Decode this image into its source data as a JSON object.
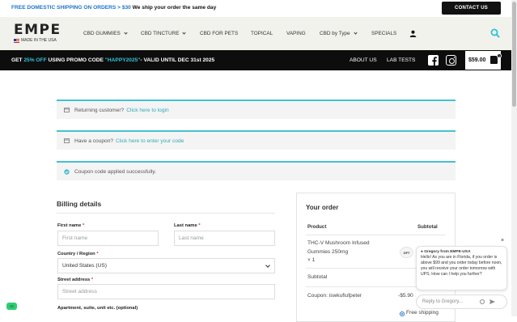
{
  "topbar": {
    "promo_prefix": "FREE DOMESTIC SHIPPING ON ORDERS > $30",
    "promo_suffix": " We ship your order the same day",
    "contact_label": "CONTACT US"
  },
  "brand": {
    "logo_word": "EMPE",
    "logo_tagline": "MADE IN THE USA"
  },
  "nav": {
    "items": [
      {
        "label": "CBD GUMMIES",
        "dropdown": true
      },
      {
        "label": "CBD TINCTURE",
        "dropdown": true
      },
      {
        "label": "CBD FOR PETS",
        "dropdown": false
      },
      {
        "label": "TOPICAL",
        "dropdown": false
      },
      {
        "label": "VAPING",
        "dropdown": false
      },
      {
        "label": "CBD by Type",
        "dropdown": true
      },
      {
        "label": "SPECIALS",
        "dropdown": false
      }
    ],
    "user_icon": "user-icon",
    "search_icon": "search-icon"
  },
  "promobar": {
    "text_a": "GET ",
    "text_pct": "25% OFF",
    "text_b": " USING PROMO CODE ",
    "text_code": "\"HAPPY2025\"",
    "text_c": "- VALID UNTIL DEC 31st 2025",
    "about_label": "ABOUT US",
    "lab_label": "LAB TESTS",
    "cart_total": "$59.00",
    "cart_count": "1"
  },
  "notices": {
    "returning_text": "Returning customer?",
    "returning_link": "Click here to login",
    "coupon_text": "Have a coupon?",
    "coupon_link": "Click here to enter your code",
    "applied_text": "Coupon code applied successfully."
  },
  "billing": {
    "title": "Billing details",
    "first_name_label": "First name",
    "first_name_placeholder": "First name",
    "last_name_label": "Last name",
    "last_name_placeholder": "Last name",
    "country_label": "Country / Region",
    "country_value": "United States (US)",
    "street_label": "Street address",
    "street_placeholder": "Street address",
    "apartment_label": "Apartment, suite, unit etc. (optional)",
    "required_mark": "*"
  },
  "order": {
    "title": "Your order",
    "col_product": "Product",
    "col_subtotal": "Subtotal",
    "item_name_line1": "THC-V Mushroom Infused",
    "item_name_line2": "Gummies 250mg",
    "item_qty": "× 1",
    "gift_badge": "GFT",
    "subtotal_label": "Subtotal",
    "coupon_label": "Coupon: iswkufiufpeter",
    "coupon_value": "-$5.90",
    "shipping_option": "Free shipping"
  },
  "chat": {
    "sender": "Gregory from EMPE-USA",
    "message": "Hello! As you are in Florida, if you order is above $99 and you order today before noon, you will receive your order tomorrow with UPS. How can I help you further?",
    "input_placeholder": "Reply to Gregory...",
    "close_glyph": "×"
  },
  "colors": {
    "accent_cyan": "#2ec4d6",
    "link_blue": "#1f74c8",
    "header_bg": "#f2f2ed",
    "promobar_bg": "#0d0d0d"
  }
}
